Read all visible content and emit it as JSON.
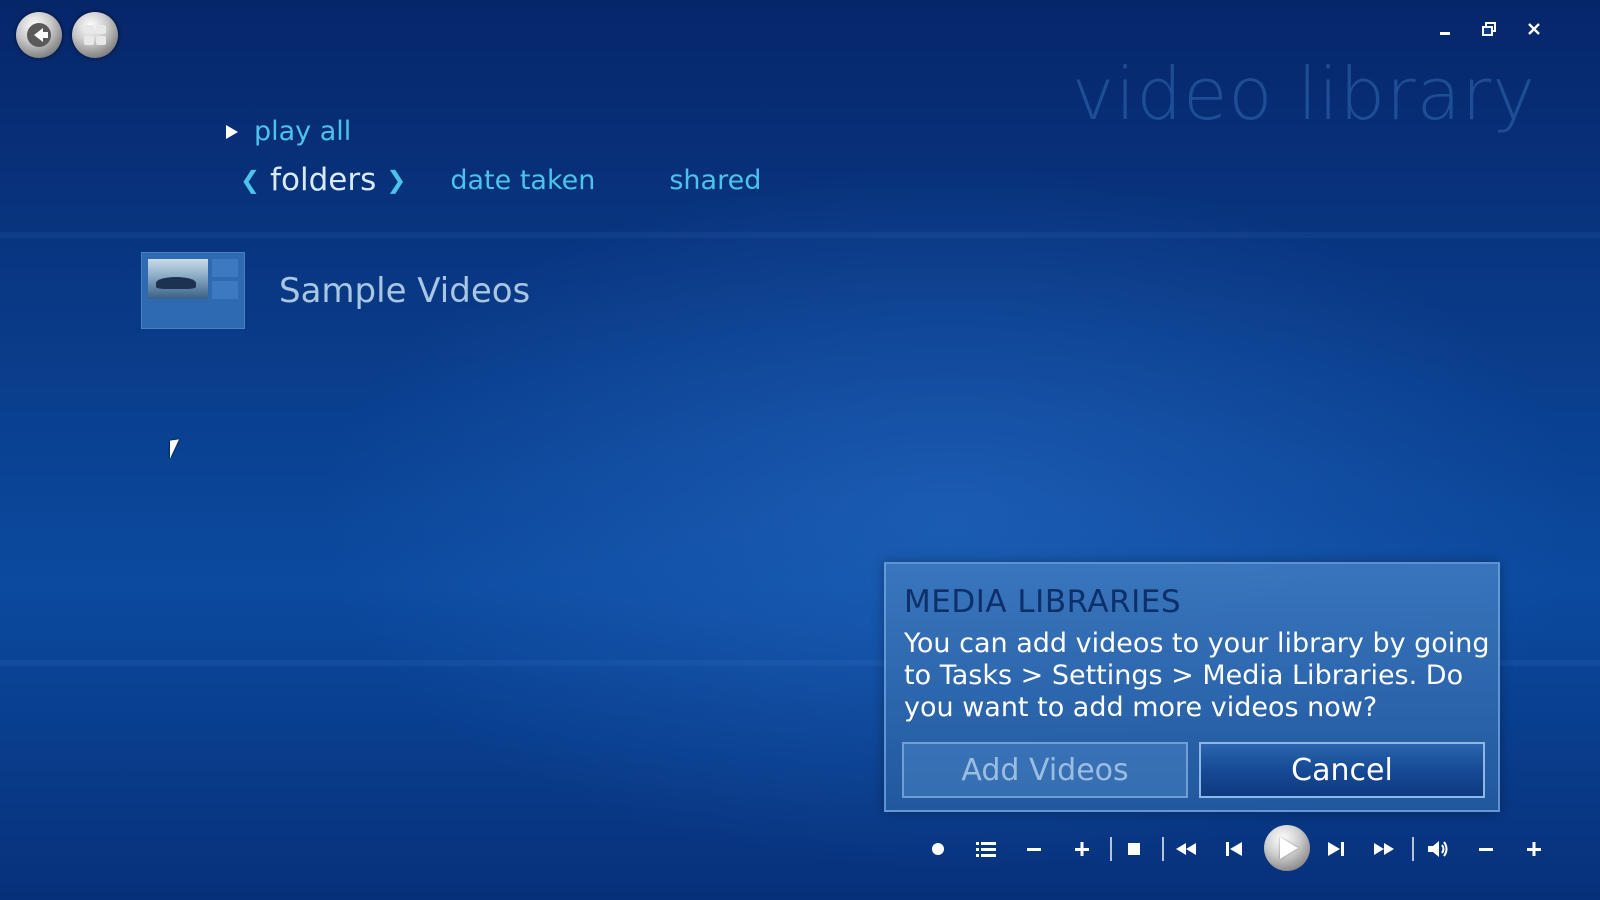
{
  "window": {
    "page_title": "video library",
    "minimize_icon": "minimize-icon",
    "restore_icon": "restore-icon",
    "close_icon": "close-icon"
  },
  "top_left": {
    "back_icon": "back-arrow-icon",
    "start_icon": "windows-logo-icon"
  },
  "play_all": {
    "label": "play all"
  },
  "tabs": [
    {
      "label": "folders",
      "active": true
    },
    {
      "label": "date taken",
      "active": false
    },
    {
      "label": "shared",
      "active": false
    }
  ],
  "items": [
    {
      "label": "Sample Videos"
    }
  ],
  "dialog": {
    "title": "MEDIA LIBRARIES",
    "message": "You can add videos to your library by going to Tasks > Settings > Media Libraries. Do you want to add more videos now?",
    "add_button": "Add Videos",
    "cancel_button": "Cancel"
  },
  "transport": {
    "icons": [
      "record-icon",
      "list-icon",
      "minus-icon",
      "plus-icon",
      "stop-icon",
      "rewind-icon",
      "previous-icon",
      "play-icon",
      "next-icon",
      "fast-forward-icon",
      "volume-icon",
      "volume-down-icon",
      "volume-up-icon"
    ]
  },
  "colors": {
    "accent": "#4cc3ea",
    "background": "#0a3f8f",
    "dialog_title": "#0d2f6a"
  }
}
